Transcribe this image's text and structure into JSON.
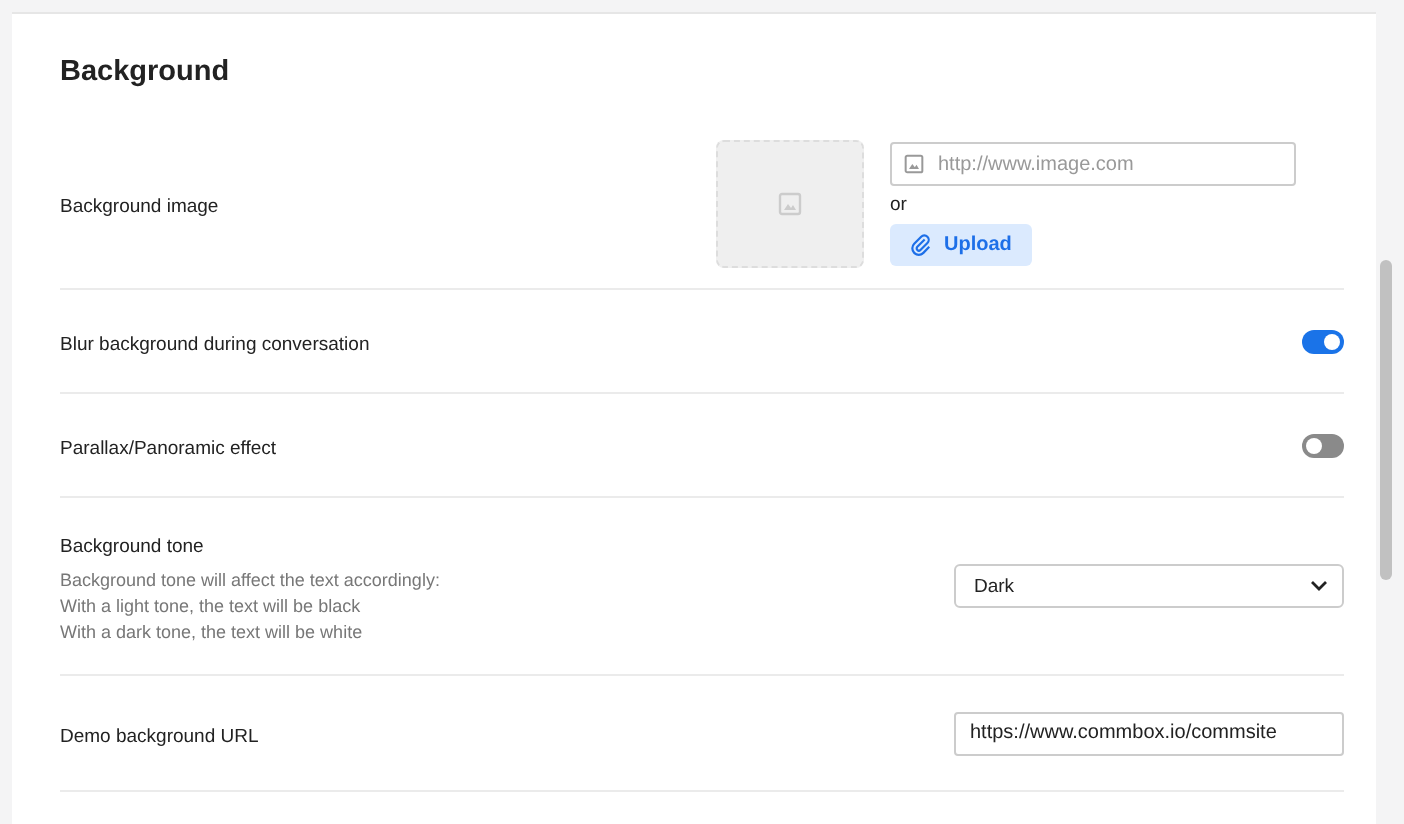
{
  "section": {
    "title": "Background"
  },
  "settings": [
    {
      "kind": "image",
      "label": "Background image",
      "url_field": {
        "placeholder": "http://www.image.com"
      },
      "separator": "or",
      "button": "Upload"
    },
    {
      "kind": "toggle",
      "label": "Blur background during conversation",
      "on": true
    },
    {
      "kind": "toggle",
      "label": "Parallax/Panoramic effect",
      "on": false
    },
    {
      "kind": "select",
      "label": "Background tone",
      "description": [
        "Background tone will affect the text accordingly:",
        "With a light tone, the text will be black",
        "With a dark tone, the text will be white"
      ],
      "value": "Dark"
    },
    {
      "kind": "text",
      "label": "Demo background URL",
      "value": "https://www.commbox.io/commsite"
    }
  ]
}
